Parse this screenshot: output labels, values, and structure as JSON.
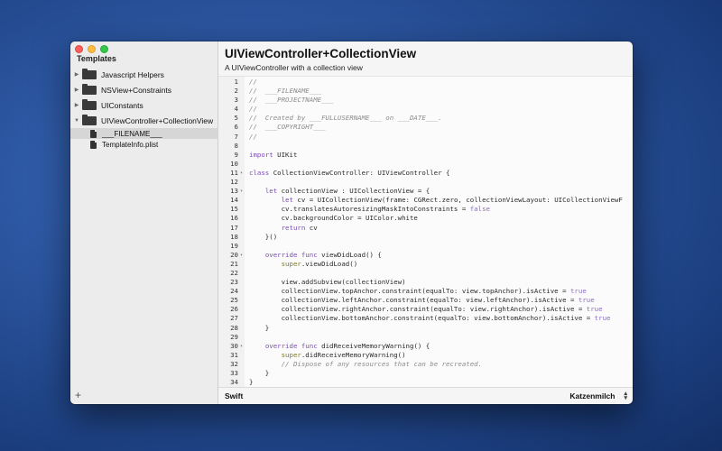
{
  "sidebar": {
    "title": "Templates",
    "add_label": "+",
    "items": [
      {
        "label": "Javascript Helpers",
        "expanded": false
      },
      {
        "label": "NSView+Constraints",
        "expanded": false
      },
      {
        "label": "UIConstants",
        "expanded": false
      },
      {
        "label": "UIViewController+CollectionView",
        "expanded": true,
        "children": [
          {
            "label": "___FILENAME___",
            "selected": true
          },
          {
            "label": "TemplateInfo.plist",
            "selected": false
          }
        ]
      }
    ]
  },
  "main": {
    "title": "UIViewController+CollectionView",
    "subtitle": "A UIViewController with a collection view"
  },
  "editor": {
    "lines": [
      {
        "n": "1",
        "fold": "",
        "tokens": [
          [
            "cm",
            "//"
          ]
        ]
      },
      {
        "n": "2",
        "fold": "",
        "tokens": [
          [
            "cm",
            "//  ___FILENAME___"
          ]
        ]
      },
      {
        "n": "3",
        "fold": "",
        "tokens": [
          [
            "cm",
            "//  ___PROJECTNAME___"
          ]
        ]
      },
      {
        "n": "4",
        "fold": "",
        "tokens": [
          [
            "cm",
            "//"
          ]
        ]
      },
      {
        "n": "5",
        "fold": "",
        "tokens": [
          [
            "cm",
            "//  Created by ___FULLUSERNAME___ on ___DATE___."
          ]
        ]
      },
      {
        "n": "6",
        "fold": "",
        "tokens": [
          [
            "cm",
            "//  ___COPYRIGHT___"
          ]
        ]
      },
      {
        "n": "7",
        "fold": "",
        "tokens": [
          [
            "cm",
            "//"
          ]
        ]
      },
      {
        "n": "8",
        "fold": "",
        "tokens": []
      },
      {
        "n": "9",
        "fold": "",
        "tokens": [
          [
            "kw",
            "import"
          ],
          [
            "pl",
            " UIKit"
          ]
        ]
      },
      {
        "n": "10",
        "fold": "",
        "tokens": []
      },
      {
        "n": "11",
        "fold": "▾",
        "tokens": [
          [
            "kw",
            "class"
          ],
          [
            "pl",
            " CollectionViewController: UIViewController {"
          ]
        ]
      },
      {
        "n": "12",
        "fold": "",
        "tokens": []
      },
      {
        "n": "13",
        "fold": "▾",
        "tokens": [
          [
            "pl",
            "    "
          ],
          [
            "kw",
            "let"
          ],
          [
            "pl",
            " collectionView : UICollectionView = {"
          ]
        ]
      },
      {
        "n": "14",
        "fold": "",
        "tokens": [
          [
            "pl",
            "        "
          ],
          [
            "kw",
            "let"
          ],
          [
            "pl",
            " cv = UICollectionView(frame: CGRect.zero, collectionViewLayout: UICollectionViewF"
          ]
        ]
      },
      {
        "n": "15",
        "fold": "",
        "tokens": [
          [
            "pl",
            "        cv.translatesAutoresizingMaskIntoConstraints = "
          ],
          [
            "lit",
            "false"
          ]
        ]
      },
      {
        "n": "16",
        "fold": "",
        "tokens": [
          [
            "pl",
            "        cv.backgroundColor = UIColor.white"
          ]
        ]
      },
      {
        "n": "17",
        "fold": "",
        "tokens": [
          [
            "pl",
            "        "
          ],
          [
            "kw",
            "return"
          ],
          [
            "pl",
            " cv"
          ]
        ]
      },
      {
        "n": "18",
        "fold": "",
        "tokens": [
          [
            "pl",
            "    }()"
          ]
        ]
      },
      {
        "n": "19",
        "fold": "",
        "tokens": []
      },
      {
        "n": "20",
        "fold": "▾",
        "tokens": [
          [
            "pl",
            "    "
          ],
          [
            "kw",
            "override func"
          ],
          [
            "pl",
            " viewDidLoad() {"
          ]
        ]
      },
      {
        "n": "21",
        "fold": "",
        "tokens": [
          [
            "pl",
            "        "
          ],
          [
            "fn",
            "super"
          ],
          [
            "pl",
            ".viewDidLoad()"
          ]
        ]
      },
      {
        "n": "22",
        "fold": "",
        "tokens": []
      },
      {
        "n": "23",
        "fold": "",
        "tokens": [
          [
            "pl",
            "        view.addSubview(collectionView)"
          ]
        ]
      },
      {
        "n": "24",
        "fold": "",
        "tokens": [
          [
            "pl",
            "        collectionView.topAnchor.constraint(equalTo: view.topAnchor).isActive = "
          ],
          [
            "lit",
            "true"
          ]
        ]
      },
      {
        "n": "25",
        "fold": "",
        "tokens": [
          [
            "pl",
            "        collectionView.leftAnchor.constraint(equalTo: view.leftAnchor).isActive = "
          ],
          [
            "lit",
            "true"
          ]
        ]
      },
      {
        "n": "26",
        "fold": "",
        "tokens": [
          [
            "pl",
            "        collectionView.rightAnchor.constraint(equalTo: view.rightAnchor).isActive = "
          ],
          [
            "lit",
            "true"
          ]
        ]
      },
      {
        "n": "27",
        "fold": "",
        "tokens": [
          [
            "pl",
            "        collectionView.bottomAnchor.constraint(equalTo: view.bottomAnchor).isActive = "
          ],
          [
            "lit",
            "true"
          ]
        ]
      },
      {
        "n": "28",
        "fold": "",
        "tokens": [
          [
            "pl",
            "    }"
          ]
        ]
      },
      {
        "n": "29",
        "fold": "",
        "tokens": []
      },
      {
        "n": "30",
        "fold": "▾",
        "tokens": [
          [
            "pl",
            "    "
          ],
          [
            "kw",
            "override func"
          ],
          [
            "pl",
            " didReceiveMemoryWarning() {"
          ]
        ]
      },
      {
        "n": "31",
        "fold": "",
        "tokens": [
          [
            "pl",
            "        "
          ],
          [
            "fn",
            "super"
          ],
          [
            "pl",
            ".didReceiveMemoryWarning()"
          ]
        ]
      },
      {
        "n": "32",
        "fold": "",
        "tokens": [
          [
            "pl",
            "        "
          ],
          [
            "cm",
            "// Dispose of any resources that can be recreated."
          ]
        ]
      },
      {
        "n": "33",
        "fold": "",
        "tokens": [
          [
            "pl",
            "    }"
          ]
        ]
      },
      {
        "n": "34",
        "fold": "",
        "tokens": [
          [
            "pl",
            "}"
          ]
        ]
      },
      {
        "n": "35",
        "fold": "",
        "tokens": []
      }
    ]
  },
  "status_bar": {
    "language": "Swift",
    "theme": "Katzenmilch"
  },
  "icons": {
    "folder": "folder-icon",
    "file": "document-icon",
    "disclosure_collapsed": "▶",
    "disclosure_expanded": "▼"
  },
  "colors": {
    "keyword": "#7b4db4",
    "comment": "#8c8c8c",
    "literal": "#8a6fbe",
    "selection": "#d6d6d6"
  }
}
